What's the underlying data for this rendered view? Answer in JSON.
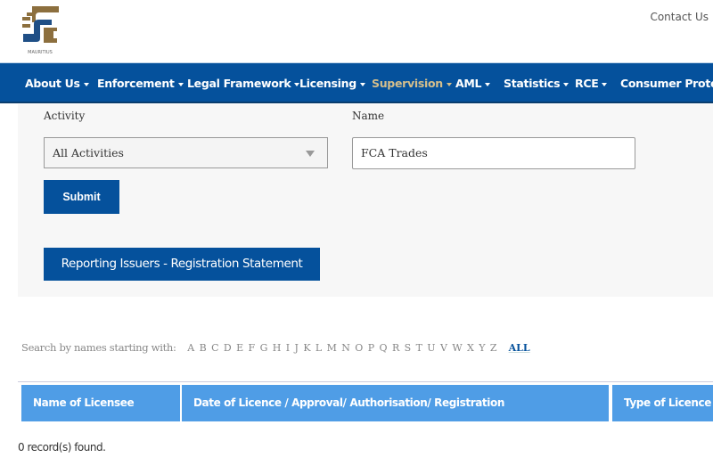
{
  "header": {
    "logo_text": "MAURITIUS",
    "contact_label": "Contact Us"
  },
  "nav": {
    "items": [
      {
        "label": "About Us",
        "active": false
      },
      {
        "label": "Enforcement",
        "active": false
      },
      {
        "label": "Legal Framework",
        "active": false
      },
      {
        "label": "Licensing",
        "active": false
      },
      {
        "label": "Supervision",
        "active": true
      },
      {
        "label": "AML",
        "active": false
      },
      {
        "label": "Statistics",
        "active": false
      },
      {
        "label": "RCE",
        "active": false
      },
      {
        "label": "Consumer Protect",
        "active": false
      }
    ]
  },
  "filter": {
    "activity_label": "Activity",
    "activity_value": "All Activities",
    "name_label": "Name",
    "name_value": "FCA Trades",
    "submit_label": "Submit",
    "reporting_button_label": "Reporting Issuers - Registration Statement"
  },
  "alphabet": {
    "label": "Search by names starting with:",
    "letters": [
      "A",
      "B",
      "C",
      "D",
      "E",
      "F",
      "G",
      "H",
      "I",
      "J",
      "K",
      "L",
      "M",
      "N",
      "O",
      "P",
      "Q",
      "R",
      "S",
      "T",
      "U",
      "V",
      "W",
      "X",
      "Y",
      "Z"
    ],
    "all_label": "ALL"
  },
  "table": {
    "columns": [
      "Name of Licensee",
      "Date of Licence / Approval/ Authorisation/ Registration",
      "Type of Licence"
    ],
    "rows": []
  },
  "records_text": "0 record(s) found.",
  "colors": {
    "brand_blue": "#05519c",
    "table_header": "#4f9de6",
    "active_nav": "#d4be8c",
    "logo_gold": "#8c6f3e"
  }
}
